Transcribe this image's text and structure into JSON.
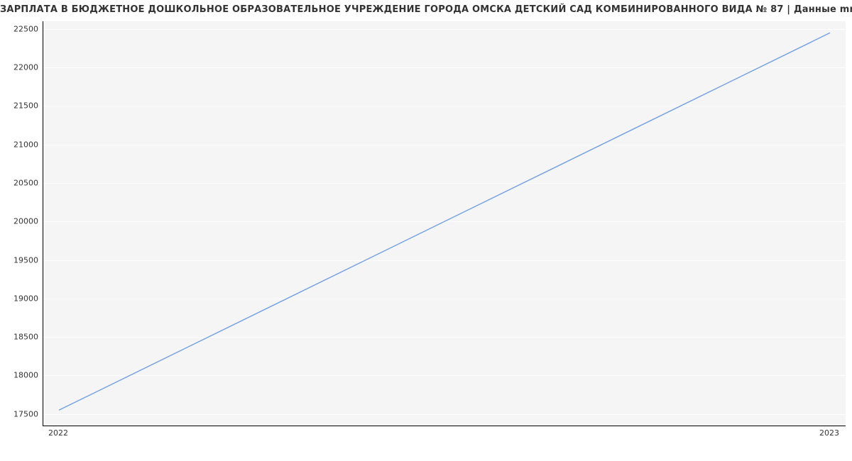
{
  "chart_data": {
    "type": "line",
    "title": "ЗАРПЛАТА В БЮДЖЕТНОЕ ДОШКОЛЬНОЕ ОБРАЗОВАТЕЛЬНОЕ УЧРЕЖДЕНИЕ ГОРОДА ОМСКА ДЕТСКИЙ САД КОМБИНИРОВАННОГО ВИДА № 87 | Данные mnogo.work",
    "x": [
      "2022",
      "2023"
    ],
    "values": [
      17550,
      22450
    ],
    "y_ticks": [
      17500,
      18000,
      18500,
      19000,
      19500,
      20000,
      20500,
      21000,
      21500,
      22000,
      22500
    ],
    "x_ticks": [
      "2022",
      "2023"
    ],
    "ylim": [
      17350,
      22600
    ],
    "xlabel": "",
    "ylabel": "",
    "line_color": "#6f9fe8",
    "plot_bg": "#f5f5f5",
    "grid_color": "#ffffff"
  }
}
